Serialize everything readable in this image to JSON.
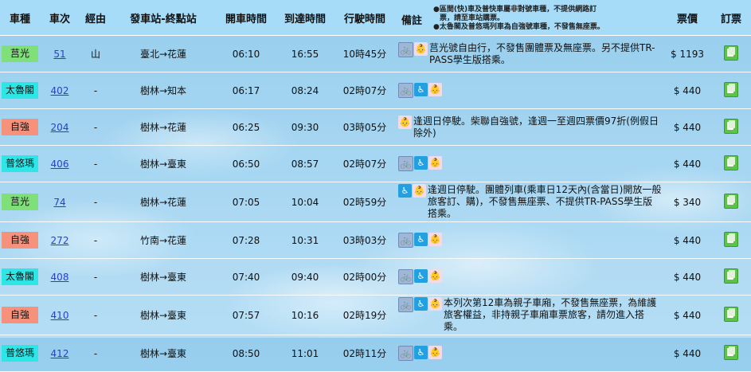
{
  "header": {
    "type": "車種",
    "train_no": "車次",
    "via": "經由",
    "route": "發車站-終點站",
    "depart": "開車時間",
    "arrive": "到達時間",
    "duration": "行駛時間",
    "note": "備註",
    "legend_1": "●區間(快)車及普快車屬非對號車種，不提供網路訂",
    "legend_2": "票，請至車站購票。",
    "legend_3": "●太魯閣及普悠瑪列車為自強號車種，不發售無座票。",
    "price": "票價",
    "book": "訂票"
  },
  "colors": {
    "莒光": "#7fe07a",
    "太魯閣": "#2ee6e6",
    "自強": "#f6917b",
    "普悠瑪": "#2ee6e6"
  },
  "rows": [
    {
      "type": "莒光",
      "no": "51",
      "via": "山",
      "route": "臺北→花蓮",
      "depart": "06:10",
      "arrive": "16:55",
      "duration": "10時45分",
      "icons": [
        "bike",
        "baby"
      ],
      "note": "莒光號自由行，不發售團體票及無座票。另不提供TR-PASS學生版搭乘。",
      "price": "$ 1193"
    },
    {
      "type": "太魯閣",
      "no": "402",
      "via": "-",
      "route": "樹林→知本",
      "depart": "06:17",
      "arrive": "08:24",
      "duration": "02時07分",
      "icons": [
        "bike",
        "wheel",
        "baby"
      ],
      "note": "",
      "price": "$ 440"
    },
    {
      "type": "自強",
      "no": "204",
      "via": "-",
      "route": "樹林→花蓮",
      "depart": "06:25",
      "arrive": "09:30",
      "duration": "03時05分",
      "icons": [
        "baby"
      ],
      "note": "逢週日停駛。柴聯自強號，逢週一至週四票價97折(例假日除外)",
      "price": "$ 440"
    },
    {
      "type": "普悠瑪",
      "no": "406",
      "via": "-",
      "route": "樹林→臺東",
      "depart": "06:50",
      "arrive": "08:57",
      "duration": "02時07分",
      "icons": [
        "bike",
        "wheel",
        "baby"
      ],
      "note": "",
      "price": "$ 440"
    },
    {
      "type": "莒光",
      "no": "74",
      "via": "-",
      "route": "樹林→花蓮",
      "depart": "07:05",
      "arrive": "10:04",
      "duration": "02時59分",
      "icons": [
        "wheel",
        "baby"
      ],
      "note": "逢週日停駛。團體列車(乘車日12天內(含當日)開放一般旅客訂、購)，不發售無座票、不提供TR-PASS學生版搭乘。",
      "price": "$ 340"
    },
    {
      "type": "自強",
      "no": "272",
      "via": "-",
      "route": "竹南→花蓮",
      "depart": "07:28",
      "arrive": "10:31",
      "duration": "03時03分",
      "icons": [
        "bike",
        "wheel",
        "baby"
      ],
      "note": "",
      "price": "$ 440"
    },
    {
      "type": "太魯閣",
      "no": "408",
      "via": "-",
      "route": "樹林→臺東",
      "depart": "07:40",
      "arrive": "09:40",
      "duration": "02時00分",
      "icons": [
        "bike",
        "wheel",
        "baby"
      ],
      "note": "",
      "price": "$ 440"
    },
    {
      "type": "自強",
      "no": "410",
      "via": "-",
      "route": "樹林→臺東",
      "depart": "07:57",
      "arrive": "10:16",
      "duration": "02時19分",
      "icons": [
        "bike",
        "wheel",
        "baby"
      ],
      "note": "本列次第12車為親子車廂，不發售無座票，為維護旅客權益，非持親子車廂車票旅客，請勿進入搭乘。",
      "price": "$ 440"
    },
    {
      "type": "普悠瑪",
      "no": "412",
      "via": "-",
      "route": "樹林→臺東",
      "depart": "08:50",
      "arrive": "11:01",
      "duration": "02時11分",
      "icons": [
        "bike",
        "wheel",
        "baby"
      ],
      "note": "",
      "price": "$ 440"
    }
  ]
}
